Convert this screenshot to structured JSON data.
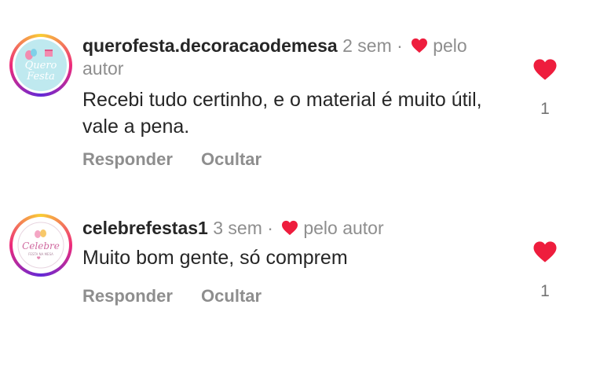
{
  "comments": [
    {
      "avatar": {
        "line1": "Quero",
        "line2": "Festa"
      },
      "username": "querofesta.decoracaodemesa",
      "time": "2 sem",
      "separator": "·",
      "liked_by_author_label": "pelo",
      "liked_by_author_label2": "autor",
      "text": "Recebi tudo certinho, e o material é muito útil, vale a pena.",
      "reply_label": "Responder",
      "hide_label": "Ocultar",
      "like_count": "1",
      "heart_color": "#ee1d3d"
    },
    {
      "avatar": {
        "line1": "Celebre",
        "line2": "FESTA NA MESA"
      },
      "username": "celebrefestas1",
      "time": "3 sem",
      "separator": "·",
      "liked_by_author_label": "pelo autor",
      "text": "Muito bom gente, só comprem",
      "reply_label": "Responder",
      "hide_label": "Ocultar",
      "like_count": "1",
      "heart_color": "#ee1d3d"
    }
  ]
}
